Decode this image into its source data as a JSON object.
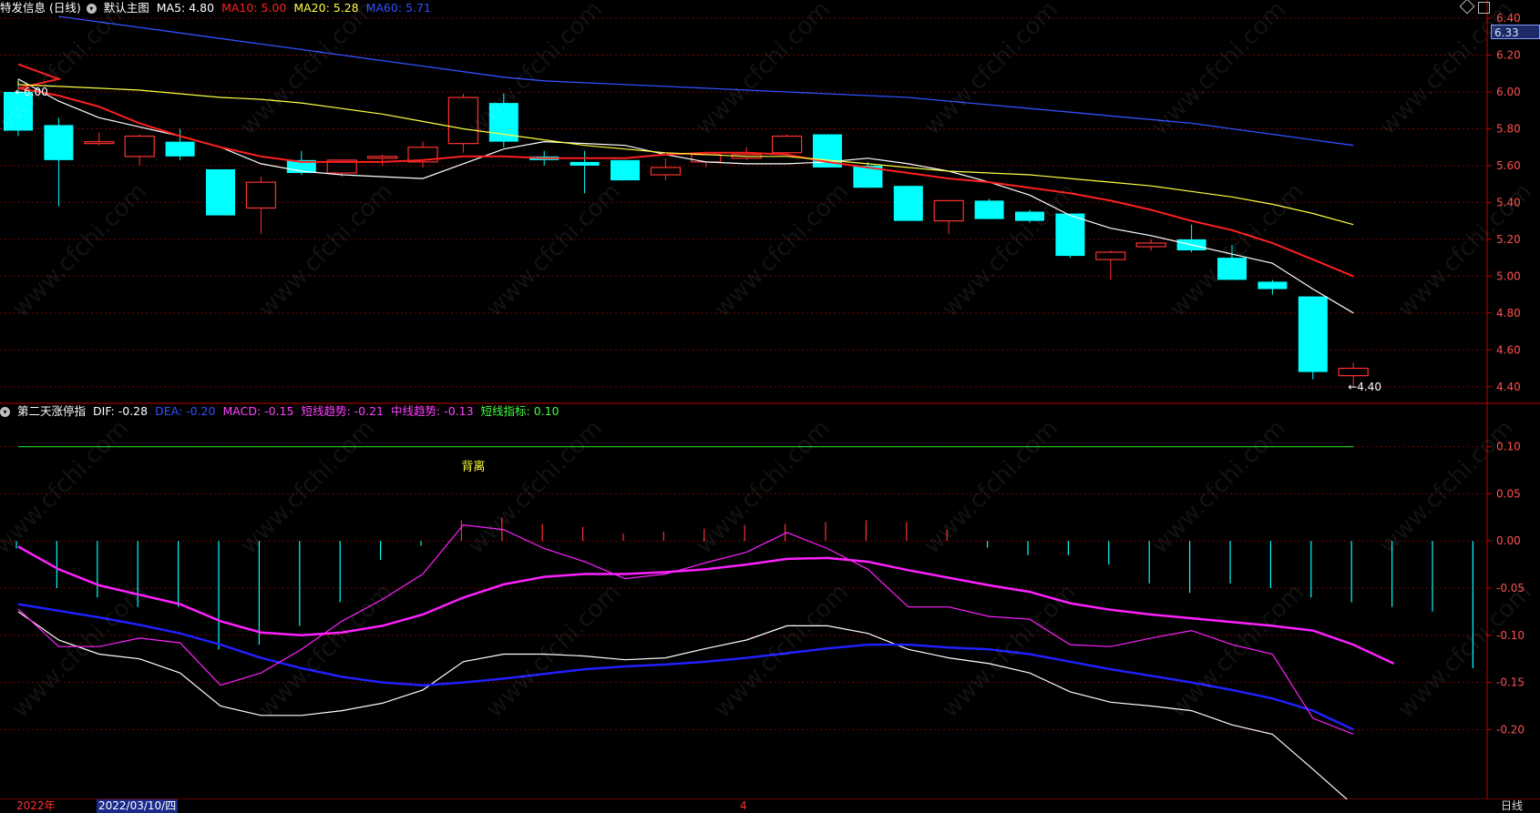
{
  "header": {
    "stock_name": "特发信息 (日线)",
    "main_chart_label": "默认主图",
    "ma5": {
      "label": "MA5: 4.80",
      "color": "#ffffff"
    },
    "ma10": {
      "label": "MA10: 5.00",
      "color": "#ff2020"
    },
    "ma20": {
      "label": "MA20: 5.28",
      "color": "#ffff40"
    },
    "ma60": {
      "label": "MA60: 5.71",
      "color": "#3050ff"
    }
  },
  "indicator_header": {
    "name": "第二天涨停指",
    "dif": {
      "label": "DIF: -0.28",
      "color": "#ffffff"
    },
    "dea": {
      "label": "DEA: -0.20",
      "color": "#3050ff"
    },
    "macd": {
      "label": "MACD: -0.15",
      "color": "#ff40ff"
    },
    "short_trend": {
      "label": "短线趋势: -0.21",
      "color": "#ff40ff"
    },
    "mid_trend": {
      "label": "中线趋势: -0.13",
      "color": "#ff40ff"
    },
    "short_index": {
      "label": "短线指标: 0.10",
      "color": "#40ff40"
    }
  },
  "current_price_box": "6.33",
  "annotations": {
    "high_marker": "←6.00",
    "low_marker": "←4.40",
    "divergence": "背离"
  },
  "bottom_bar": {
    "year": "2022年",
    "date": "2022/03/10/四",
    "marker": "4",
    "period": "日线"
  },
  "watermark": "www.cfchi.com",
  "colors": {
    "up": "#ff3030",
    "down": "#00ffff",
    "grid": "#7a0000",
    "axis": "#c00000",
    "axis_text": "#ff5050"
  },
  "chart_data": [
    {
      "type": "candlestick",
      "y_ticks": [
        "6.40",
        "6.20",
        "6.00",
        "5.80",
        "5.60",
        "5.40",
        "5.20",
        "5.00",
        "4.80",
        "4.60",
        "4.40"
      ],
      "ylim": [
        4.31,
        6.41
      ],
      "candles": [
        {
          "o": 6.0,
          "h": 6.07,
          "l": 5.76,
          "c": 5.79
        },
        {
          "o": 5.82,
          "h": 5.86,
          "l": 5.38,
          "c": 5.63
        },
        {
          "o": 5.72,
          "h": 5.78,
          "l": 5.71,
          "c": 5.73
        },
        {
          "o": 5.65,
          "h": 5.77,
          "l": 5.6,
          "c": 5.76
        },
        {
          "o": 5.73,
          "h": 5.8,
          "l": 5.63,
          "c": 5.65
        },
        {
          "o": 5.58,
          "h": 5.58,
          "l": 5.33,
          "c": 5.33
        },
        {
          "o": 5.37,
          "h": 5.54,
          "l": 5.23,
          "c": 5.51
        },
        {
          "o": 5.63,
          "h": 5.68,
          "l": 5.55,
          "c": 5.56
        },
        {
          "o": 5.56,
          "h": 5.63,
          "l": 5.54,
          "c": 5.63
        },
        {
          "o": 5.64,
          "h": 5.66,
          "l": 5.6,
          "c": 5.65
        },
        {
          "o": 5.62,
          "h": 5.73,
          "l": 5.59,
          "c": 5.7
        },
        {
          "o": 5.72,
          "h": 5.99,
          "l": 5.67,
          "c": 5.97
        },
        {
          "o": 5.94,
          "h": 5.99,
          "l": 5.7,
          "c": 5.73
        },
        {
          "o": 5.65,
          "h": 5.68,
          "l": 5.6,
          "c": 5.63
        },
        {
          "o": 5.62,
          "h": 5.68,
          "l": 5.45,
          "c": 5.6
        },
        {
          "o": 5.63,
          "h": 5.63,
          "l": 5.52,
          "c": 5.52
        },
        {
          "o": 5.55,
          "h": 5.64,
          "l": 5.52,
          "c": 5.59
        },
        {
          "o": 5.62,
          "h": 5.67,
          "l": 5.59,
          "c": 5.66
        },
        {
          "o": 5.64,
          "h": 5.7,
          "l": 5.63,
          "c": 5.66
        },
        {
          "o": 5.67,
          "h": 5.77,
          "l": 5.66,
          "c": 5.76
        },
        {
          "o": 5.77,
          "h": 5.77,
          "l": 5.59,
          "c": 5.59
        },
        {
          "o": 5.6,
          "h": 5.62,
          "l": 5.48,
          "c": 5.48
        },
        {
          "o": 5.49,
          "h": 5.49,
          "l": 5.3,
          "c": 5.3
        },
        {
          "o": 5.3,
          "h": 5.41,
          "l": 5.23,
          "c": 5.41
        },
        {
          "o": 5.41,
          "h": 5.42,
          "l": 5.31,
          "c": 5.31
        },
        {
          "o": 5.35,
          "h": 5.36,
          "l": 5.29,
          "c": 5.3
        },
        {
          "o": 5.34,
          "h": 5.34,
          "l": 5.1,
          "c": 5.11
        },
        {
          "o": 5.09,
          "h": 5.14,
          "l": 4.98,
          "c": 5.13
        },
        {
          "o": 5.16,
          "h": 5.2,
          "l": 5.14,
          "c": 5.18
        },
        {
          "o": 5.2,
          "h": 5.28,
          "l": 5.13,
          "c": 5.14
        },
        {
          "o": 5.1,
          "h": 5.17,
          "l": 4.98,
          "c": 4.98
        },
        {
          "o": 4.97,
          "h": 4.98,
          "l": 4.9,
          "c": 4.93
        },
        {
          "o": 4.89,
          "h": 4.89,
          "l": 4.44,
          "c": 4.48
        },
        {
          "o": 4.46,
          "h": 4.53,
          "l": 4.4,
          "c": 4.5
        }
      ],
      "series": [
        {
          "name": "MA5",
          "color": "#ffffff",
          "values": [
            6.07,
            5.95,
            5.86,
            5.81,
            5.76,
            5.7,
            5.61,
            5.57,
            5.55,
            5.54,
            5.53,
            5.61,
            5.69,
            5.73,
            5.72,
            5.71,
            5.66,
            5.62,
            5.61,
            5.61,
            5.62,
            5.64,
            5.61,
            5.57,
            5.51,
            5.44,
            5.33,
            5.26,
            5.22,
            5.17,
            5.12,
            5.07,
            4.93,
            4.8
          ]
        },
        {
          "name": "MA10",
          "color": "#ff2020",
          "values": [
            6.15,
            6.07,
            6.02,
            5.98,
            5.92,
            5.83,
            5.76,
            5.7,
            5.65,
            5.62,
            5.62,
            5.62,
            5.63,
            5.65,
            5.65,
            5.64,
            5.64,
            5.64,
            5.66,
            5.67,
            5.67,
            5.66,
            5.62,
            5.59,
            5.56,
            5.53,
            5.51,
            5.48,
            5.45,
            5.41,
            5.36,
            5.3,
            5.25,
            5.18,
            5.09,
            5.0
          ]
        },
        {
          "name": "MA20",
          "color": "#ffff40",
          "values": [
            6.06,
            6.04,
            6.03,
            6.02,
            6.01,
            5.99,
            5.97,
            5.96,
            5.94,
            5.91,
            5.88,
            5.84,
            5.8,
            5.77,
            5.74,
            5.71,
            5.69,
            5.67,
            5.66,
            5.65,
            5.65,
            5.63,
            5.61,
            5.59,
            5.57,
            5.56,
            5.55,
            5.53,
            5.51,
            5.49,
            5.46,
            5.43,
            5.39,
            5.34,
            5.28
          ]
        },
        {
          "name": "MA60",
          "color": "#3050ff",
          "values": [
            6.41,
            6.38,
            6.35,
            6.32,
            6.29,
            6.26,
            6.23,
            6.2,
            6.17,
            6.14,
            6.11,
            6.08,
            6.06,
            6.05,
            6.04,
            6.03,
            6.02,
            6.01,
            6.0,
            5.99,
            5.98,
            5.97,
            5.95,
            5.93,
            5.91,
            5.89,
            5.87,
            5.85,
            5.83,
            5.8,
            5.77,
            5.74,
            5.71
          ]
        }
      ]
    },
    {
      "type": "line",
      "y_ticks": [
        "0.10",
        "0.05",
        "0.00",
        "-0.05",
        "-0.10",
        "-0.15",
        "-0.20"
      ],
      "ylim": [
        -0.274,
        0.146
      ],
      "histogram": [
        -0.008,
        -0.05,
        -0.06,
        -0.07,
        -0.07,
        -0.115,
        -0.11,
        -0.09,
        -0.065,
        -0.02,
        -0.005,
        0.022,
        0.025,
        0.018,
        0.015,
        0.008,
        0.01,
        0.013,
        0.017,
        0.018,
        0.02,
        0.022,
        0.02,
        0.012,
        -0.007,
        -0.015,
        -0.015,
        -0.025,
        -0.045,
        -0.055,
        -0.045,
        -0.05,
        -0.06,
        -0.065,
        -0.07,
        -0.075,
        -0.135
      ],
      "series": [
        {
          "name": "DIF",
          "color": "#ffffff",
          "values": [
            -0.075,
            -0.105,
            -0.12,
            -0.125,
            -0.14,
            -0.175,
            -0.185,
            -0.185,
            -0.18,
            -0.172,
            -0.158,
            -0.128,
            -0.12,
            -0.12,
            -0.122,
            -0.126,
            -0.124,
            -0.114,
            -0.105,
            -0.09,
            -0.09,
            -0.098,
            -0.115,
            -0.124,
            -0.13,
            -0.14,
            -0.16,
            -0.171,
            -0.175,
            -0.18,
            -0.195,
            -0.205,
            -0.242,
            -0.28
          ]
        },
        {
          "name": "DEA",
          "color": "#2020ff",
          "values": [
            -0.067,
            -0.074,
            -0.081,
            -0.089,
            -0.098,
            -0.11,
            -0.124,
            -0.135,
            -0.144,
            -0.15,
            -0.153,
            -0.15,
            -0.146,
            -0.141,
            -0.136,
            -0.133,
            -0.131,
            -0.128,
            -0.124,
            -0.119,
            -0.114,
            -0.11,
            -0.11,
            -0.113,
            -0.115,
            -0.12,
            -0.128,
            -0.136,
            -0.143,
            -0.15,
            -0.158,
            -0.167,
            -0.18,
            -0.2
          ]
        },
        {
          "name": "MACD",
          "color": "#ff20ff",
          "values": [
            -0.072,
            -0.112,
            -0.112,
            -0.103,
            -0.108,
            -0.153,
            -0.14,
            -0.115,
            -0.085,
            -0.062,
            -0.035,
            0.017,
            0.012,
            -0.008,
            -0.022,
            -0.04,
            -0.035,
            -0.023,
            -0.012,
            0.009,
            -0.008,
            -0.03,
            -0.07,
            -0.07,
            -0.08,
            -0.083,
            -0.11,
            -0.112,
            -0.103,
            -0.095,
            -0.11,
            -0.12,
            -0.188,
            -0.205
          ]
        },
        {
          "name": "短线趋势",
          "color": "#ff20ff",
          "values": [
            -0.006,
            -0.03,
            -0.047,
            -0.057,
            -0.067,
            -0.085,
            -0.097,
            -0.1,
            -0.097,
            -0.09,
            -0.078,
            -0.06,
            -0.046,
            -0.038,
            -0.035,
            -0.035,
            -0.033,
            -0.03,
            -0.025,
            -0.019,
            -0.018,
            -0.022,
            -0.031,
            -0.039,
            -0.047,
            -0.054,
            -0.066,
            -0.073,
            -0.078,
            -0.082,
            -0.086,
            -0.09,
            -0.095,
            -0.11,
            -0.13
          ]
        },
        {
          "name": "短线指标",
          "color": "#20c020",
          "values": [
            0.1,
            0.1
          ]
        }
      ]
    }
  ]
}
